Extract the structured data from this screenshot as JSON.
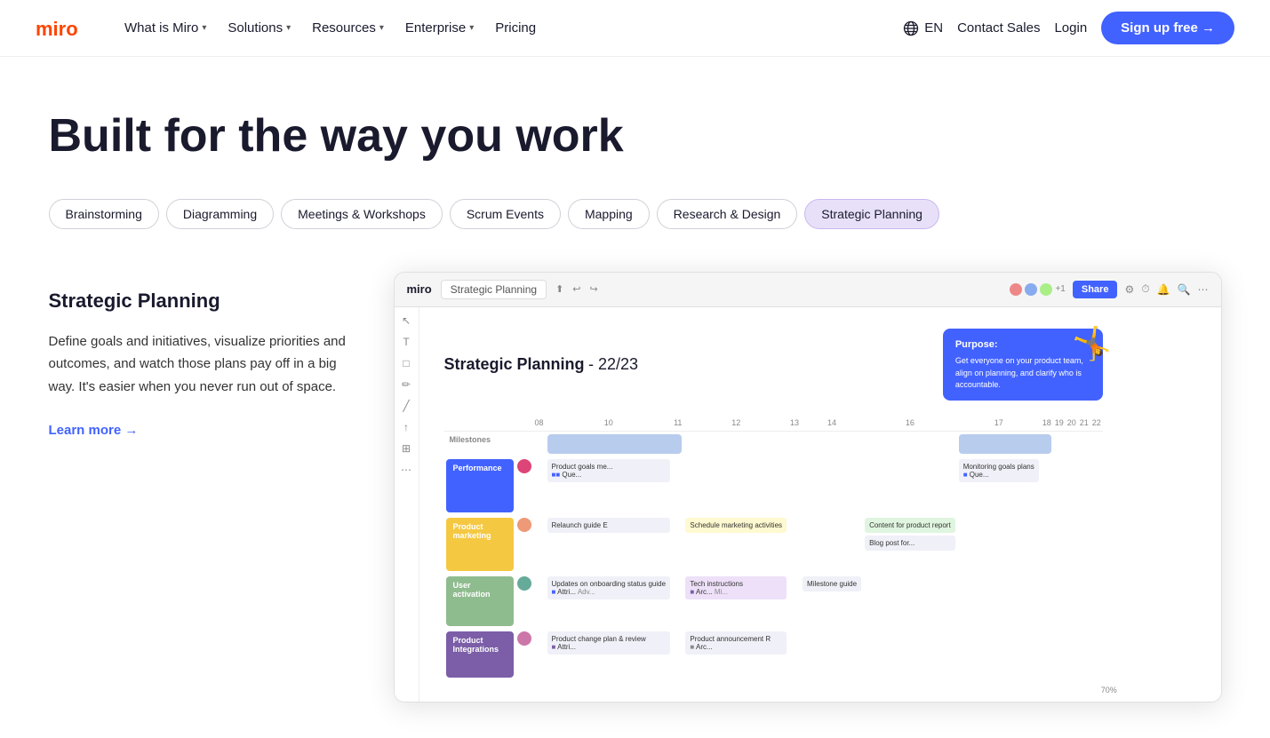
{
  "nav": {
    "logo_text": "miro",
    "links": [
      {
        "label": "What is Miro",
        "has_dropdown": true
      },
      {
        "label": "Solutions",
        "has_dropdown": true
      },
      {
        "label": "Resources",
        "has_dropdown": true
      },
      {
        "label": "Enterprise",
        "has_dropdown": true
      },
      {
        "label": "Pricing",
        "has_dropdown": false
      }
    ],
    "lang": "EN",
    "contact_sales": "Contact Sales",
    "login": "Login",
    "signup": "Sign up free →"
  },
  "hero": {
    "title": "Built for the way you work"
  },
  "tabs": [
    {
      "id": "brainstorming",
      "label": "Brainstorming",
      "active": false
    },
    {
      "id": "diagramming",
      "label": "Diagramming",
      "active": false
    },
    {
      "id": "meetings",
      "label": "Meetings & Workshops",
      "active": false
    },
    {
      "id": "scrum",
      "label": "Scrum Events",
      "active": false
    },
    {
      "id": "mapping",
      "label": "Mapping",
      "active": false
    },
    {
      "id": "research",
      "label": "Research & Design",
      "active": false
    },
    {
      "id": "strategic",
      "label": "Strategic Planning",
      "active": true
    }
  ],
  "content": {
    "title": "Strategic Planning",
    "description": "Define goals and initiatives, visualize priorities and outcomes, and watch those plans pay off in a big way. It's easier when you never run out of space.",
    "learn_more": "Learn more →"
  },
  "board": {
    "logo": "miro",
    "tab_label": "Strategic Planning",
    "share_label": "Share",
    "main_title": "Strategic Planning",
    "subtitle": " - 22/23",
    "purpose_title": "Purpose:",
    "purpose_text": "Get everyone on your product team, align on planning, and clarify who is accountable.",
    "col_headers": [
      "08",
      "10",
      "11",
      "12",
      "13",
      "14",
      "16",
      "17",
      "18",
      "19",
      "20",
      "21",
      "22"
    ],
    "rows": [
      {
        "label": "Milestones",
        "label_color": "transparent",
        "label_text_color": "#888"
      },
      {
        "label": "Performance",
        "label_color": "#4262ff"
      },
      {
        "label": "Product marketing",
        "label_color": "#f5c842"
      },
      {
        "label": "User activation",
        "label_color": "#8fbc8f"
      },
      {
        "label": "Product Integrations",
        "label_color": "#7b5ea7"
      }
    ]
  },
  "colors": {
    "accent": "#4262ff",
    "active_tab_bg": "#e8e0f8",
    "active_tab_border": "#c8b8f0"
  }
}
